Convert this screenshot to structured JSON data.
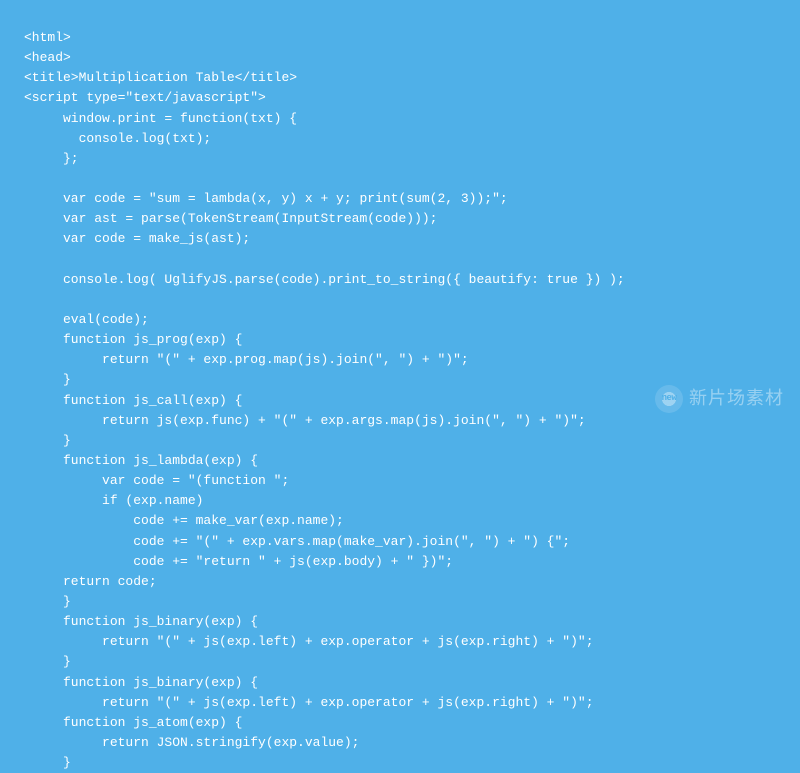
{
  "code": {
    "lines": [
      "<html>",
      "<head>",
      "<title>Multiplication Table</title>",
      "<script type=\"text/javascript\">",
      "     window.print = function(txt) {",
      "       console.log(txt);",
      "     };",
      "",
      "     var code = \"sum = lambda(x, y) x + y; print(sum(2, 3));\";",
      "     var ast = parse(TokenStream(InputStream(code)));",
      "     var code = make_js(ast);",
      "",
      "     console.log( UglifyJS.parse(code).print_to_string({ beautify: true }) );",
      "",
      "     eval(code);",
      "     function js_prog(exp) {",
      "          return \"(\" + exp.prog.map(js).join(\", \") + \")\";",
      "     }",
      "     function js_call(exp) {",
      "          return js(exp.func) + \"(\" + exp.args.map(js).join(\", \") + \")\";",
      "     }",
      "     function js_lambda(exp) {",
      "          var code = \"(function \";",
      "          if (exp.name)",
      "              code += make_var(exp.name);",
      "              code += \"(\" + exp.vars.map(make_var).join(\", \") + \") {\";",
      "              code += \"return \" + js(exp.body) + \" })\";",
      "     return code;",
      "     }",
      "     function js_binary(exp) {",
      "          return \"(\" + js(exp.left) + exp.operator + js(exp.right) + \")\";",
      "     }",
      "     function js_binary(exp) {",
      "          return \"(\" + js(exp.left) + exp.operator + js(exp.right) + \")\";",
      "     function js_atom(exp) {",
      "          return JSON.stringify(exp.value);",
      "     }"
    ]
  },
  "watermark": {
    "badge": "new",
    "text": "新片场素材"
  }
}
